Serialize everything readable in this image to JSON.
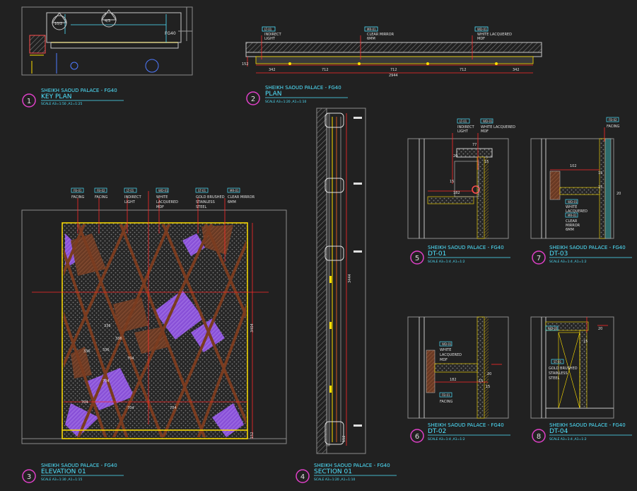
{
  "project": "SHEIKH SAOUD PALACE - FG40",
  "views": [
    {
      "num": "1",
      "title": "KEY PLAN",
      "scale": "SCALE   A3=1:50 ,A1=1:25"
    },
    {
      "num": "2",
      "title": "PLAN",
      "scale": "SCALE   A3=1:20 ,A1=1:10"
    },
    {
      "num": "3",
      "title": "ELEVATION 01",
      "scale": "SCALE   A3=1:30 ,A1=1:15"
    },
    {
      "num": "4",
      "title": "SECTION 01",
      "scale": "SCALE   A3=1:20 ,A1=1:10"
    },
    {
      "num": "5",
      "title": "DT-01",
      "scale": "SCALE   A3=1:4 ,A1=1:2"
    },
    {
      "num": "6",
      "title": "DT-02",
      "scale": "SCALE   A3=1:4 ,A1=1:2"
    },
    {
      "num": "7",
      "title": "DT-03",
      "scale": "SCALE   A3=1:4 ,A1=1:2"
    },
    {
      "num": "8",
      "title": "DT-04",
      "scale": "SCALE   A3=1:4 ,A1=1:2"
    }
  ],
  "keyplan": {
    "tag_a": "10/2",
    "tag_b": "4/3",
    "room": "FG40"
  },
  "plan": {
    "callouts": [
      {
        "tag": "LT-01",
        "text": [
          "INDIRECT",
          "LIGHT"
        ]
      },
      {
        "tag": "MR-01",
        "text": [
          "CLEAR MIRROR",
          "6MM"
        ]
      },
      {
        "tag": "WD-01",
        "text": [
          "WHITE LACQUERED",
          "MDF"
        ]
      }
    ],
    "dims": [
      "342",
      "712",
      "712",
      "712",
      "342",
      "2944",
      "152"
    ]
  },
  "elevation": {
    "callouts": [
      {
        "tag": "FB-01",
        "text": [
          "FACING"
        ]
      },
      {
        "tag": "FB-02",
        "text": [
          "FACING"
        ]
      },
      {
        "tag": "LT-01",
        "text": [
          "INDIRECT",
          "LIGHT"
        ]
      },
      {
        "tag": "WD-01",
        "text": [
          "WHITE",
          "LACQUERED",
          "MDF"
        ]
      },
      {
        "tag": "ST-01",
        "text": [
          "GOLD BRUSHED",
          "STAINLESS",
          "STEEL"
        ]
      },
      {
        "tag": "MR-01",
        "text": [
          "CLEAR MIRROR",
          "6MM"
        ]
      }
    ],
    "dims": [
      "336",
      "336",
      "336",
      "336",
      "704",
      "704",
      "704",
      "704",
      "704",
      "3404",
      "152"
    ]
  },
  "section": {
    "dims": [
      "3444",
      "152"
    ]
  },
  "dt01": {
    "callouts": [
      {
        "tag": "LT-01",
        "text": [
          "INDIRECT",
          "LIGHT"
        ]
      },
      {
        "tag": "WD-01",
        "text": [
          "WHITE LACQUERED",
          "MDF"
        ]
      }
    ],
    "dims": [
      "77",
      "20",
      "15",
      "182",
      "15"
    ]
  },
  "dt02": {
    "callouts": [
      {
        "tag": "WD-01",
        "text": [
          "WHITE",
          "LACQUERED",
          "MDF"
        ]
      },
      {
        "tag": "FB-01",
        "text": [
          "FACING"
        ]
      }
    ],
    "dims": [
      "20",
      "182",
      "15",
      "15"
    ]
  },
  "dt03": {
    "callouts": [
      {
        "tag": "FB-02",
        "text": [
          "FACING"
        ]
      },
      {
        "tag": "WD-01",
        "text": [
          "WHITE",
          "LACQUERED",
          "MDF"
        ]
      },
      {
        "tag": "MR-01",
        "text": [
          "CLEAR",
          "MIRROR",
          "6MM"
        ]
      }
    ],
    "dims": [
      "102",
      "15",
      "20",
      "15"
    ]
  },
  "dt04": {
    "callouts": [
      {
        "tag": "WD-01",
        "text": []
      },
      {
        "tag": "ST-01",
        "text": [
          "GOLD BRUSHED",
          "STAINLESS",
          "STEEL"
        ]
      }
    ],
    "dims": [
      "20",
      "15"
    ]
  },
  "colors": {
    "bg": "#212121",
    "cyan": "#4fe3ff",
    "magenta": "#e040c8",
    "red": "#ff2a2a",
    "yellow": "#ffe000",
    "purple": "#9a5ce0",
    "brown": "#7a3c20"
  }
}
